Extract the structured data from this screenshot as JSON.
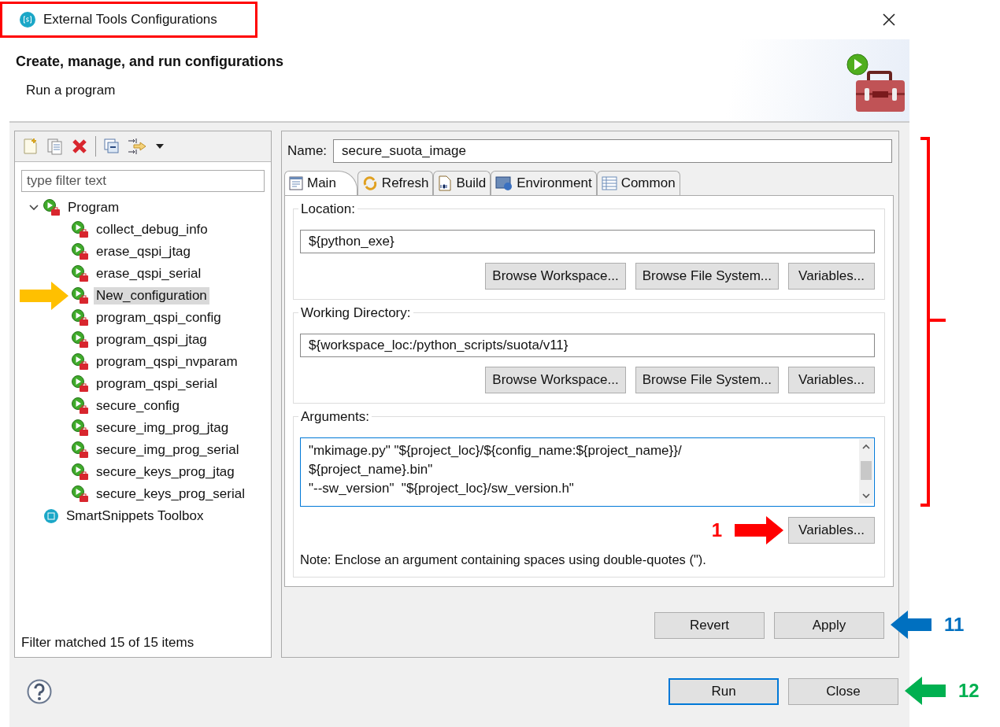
{
  "window": {
    "title": "External Tools Configurations",
    "highlighted": true
  },
  "header": {
    "title": "Create, manage, and run configurations",
    "subtitle": "Run a program"
  },
  "filter": {
    "placeholder": "type filter text"
  },
  "tree": [
    {
      "label": "Program",
      "kind": "group",
      "expanded": true,
      "selected": false,
      "children": [
        {
          "label": "collect_debug_info",
          "kind": "program",
          "selected": false
        },
        {
          "label": "erase_qspi_jtag",
          "kind": "program",
          "selected": false
        },
        {
          "label": "erase_qspi_serial",
          "kind": "program",
          "selected": false
        },
        {
          "label": "New_configuration",
          "kind": "program",
          "selected": true,
          "callout": {
            "color": "#ffc000"
          }
        },
        {
          "label": "program_qspi_config",
          "kind": "program",
          "selected": false
        },
        {
          "label": "program_qspi_jtag",
          "kind": "program",
          "selected": false
        },
        {
          "label": "program_qspi_nvparam",
          "kind": "program",
          "selected": false
        },
        {
          "label": "program_qspi_serial",
          "kind": "program",
          "selected": false
        },
        {
          "label": "secure_config",
          "kind": "program",
          "selected": false
        },
        {
          "label": "secure_img_prog_jtag",
          "kind": "program",
          "selected": false
        },
        {
          "label": "secure_img_prog_serial",
          "kind": "program",
          "selected": false
        },
        {
          "label": "secure_keys_prog_jtag",
          "kind": "program",
          "selected": false
        },
        {
          "label": "secure_keys_prog_serial",
          "kind": "program",
          "selected": false
        }
      ]
    },
    {
      "label": "SmartSnippets Toolbox",
      "kind": "toolbox",
      "selected": false
    }
  ],
  "filter_status": "Filter matched 15 of 15 items",
  "name_field": {
    "label": "Name:",
    "value": "secure_suota_image"
  },
  "tabs": [
    {
      "label": "Main",
      "kind": "main",
      "selected": true
    },
    {
      "label": "Refresh",
      "kind": "refresh",
      "selected": false
    },
    {
      "label": "Build",
      "kind": "build",
      "selected": false
    },
    {
      "label": "Environment",
      "kind": "environment",
      "selected": false
    },
    {
      "label": "Common",
      "kind": "common",
      "selected": false
    }
  ],
  "location": {
    "label": "Location:",
    "value": "${python_exe}",
    "buttons": [
      "Browse Workspace...",
      "Browse File System...",
      "Variables..."
    ]
  },
  "working_directory": {
    "label": "Working Directory:",
    "value": "${workspace_loc:/python_scripts/suota/v11}",
    "buttons": [
      "Browse Workspace...",
      "Browse File System...",
      "Variables..."
    ]
  },
  "arguments": {
    "label": "Arguments:",
    "lines": [
      "\"mkimage.py\" \"${project_loc}/${config_name:${project_name}}/",
      "${project_name}.bin\"",
      "\"--sw_version\"  \"${project_loc}/sw_version.h\""
    ],
    "button": "Variables...",
    "callout": {
      "label": "1",
      "color": "#ff0000"
    },
    "note": "Note: Enclose an argument containing spaces using double-quotes (\")."
  },
  "revert_button": "Revert",
  "apply_button": {
    "label": "Apply",
    "callout": {
      "label": "11",
      "color": "#0070c0"
    }
  },
  "run_button": "Run",
  "close_button": {
    "label": "Close",
    "callout": {
      "label": "12",
      "color": "#00b050"
    }
  },
  "bracket": {
    "color": "#ff0000"
  }
}
